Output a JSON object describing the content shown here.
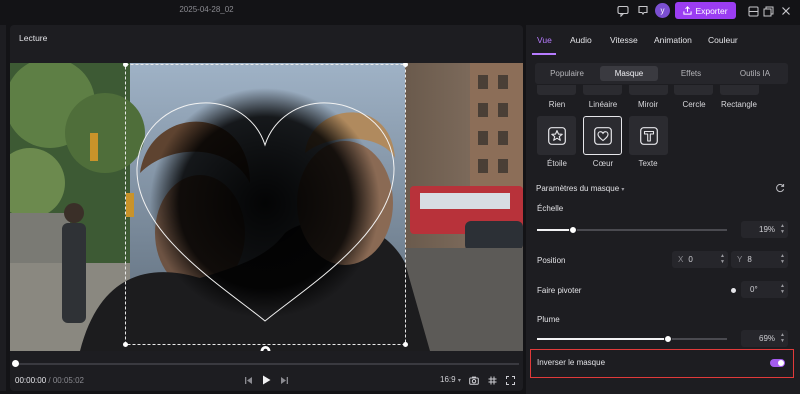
{
  "titlebar": {
    "project_name": "2025-04-28_02",
    "avatar_letter": "y",
    "export_label": "Exporter"
  },
  "player": {
    "title": "Lecture",
    "current_time": "00:00:00",
    "separator": "/",
    "duration": "00:05:02",
    "aspect_ratio": "16:9"
  },
  "panel": {
    "tabs": [
      "Vue",
      "Audio",
      "Vitesse",
      "Animation",
      "Couleur"
    ],
    "active_tab": "Vue",
    "subtabs": [
      "Populaire",
      "Masque",
      "Effets",
      "Outils IA"
    ],
    "active_subtab": "Masque",
    "shapes_row1": [
      "Rien",
      "Linéaire",
      "Miroir",
      "Cercle",
      "Rectangle"
    ],
    "shapes_row2": [
      {
        "label": "Étoile",
        "icon": "star-icon"
      },
      {
        "label": "Cœur",
        "icon": "heart-icon"
      },
      {
        "label": "Texte",
        "icon": "text-icon"
      }
    ],
    "selected_shape": "Cœur",
    "mask_params_label": "Paramètres du masque",
    "scale": {
      "label": "Échelle",
      "value": "19%",
      "fraction": 0.19
    },
    "position": {
      "label": "Position",
      "x_label": "X",
      "x_value": "0",
      "y_label": "Y",
      "y_value": "8"
    },
    "rotate": {
      "label": "Faire pivoter",
      "value": "0°"
    },
    "feather": {
      "label": "Plume",
      "value": "69%",
      "fraction": 0.69
    },
    "invert": {
      "label": "Inverser le masque",
      "on": true
    }
  },
  "colors": {
    "accent": "#9b3df2",
    "active_tab": "#b77cff",
    "highlight_border": "#e03a3a"
  }
}
